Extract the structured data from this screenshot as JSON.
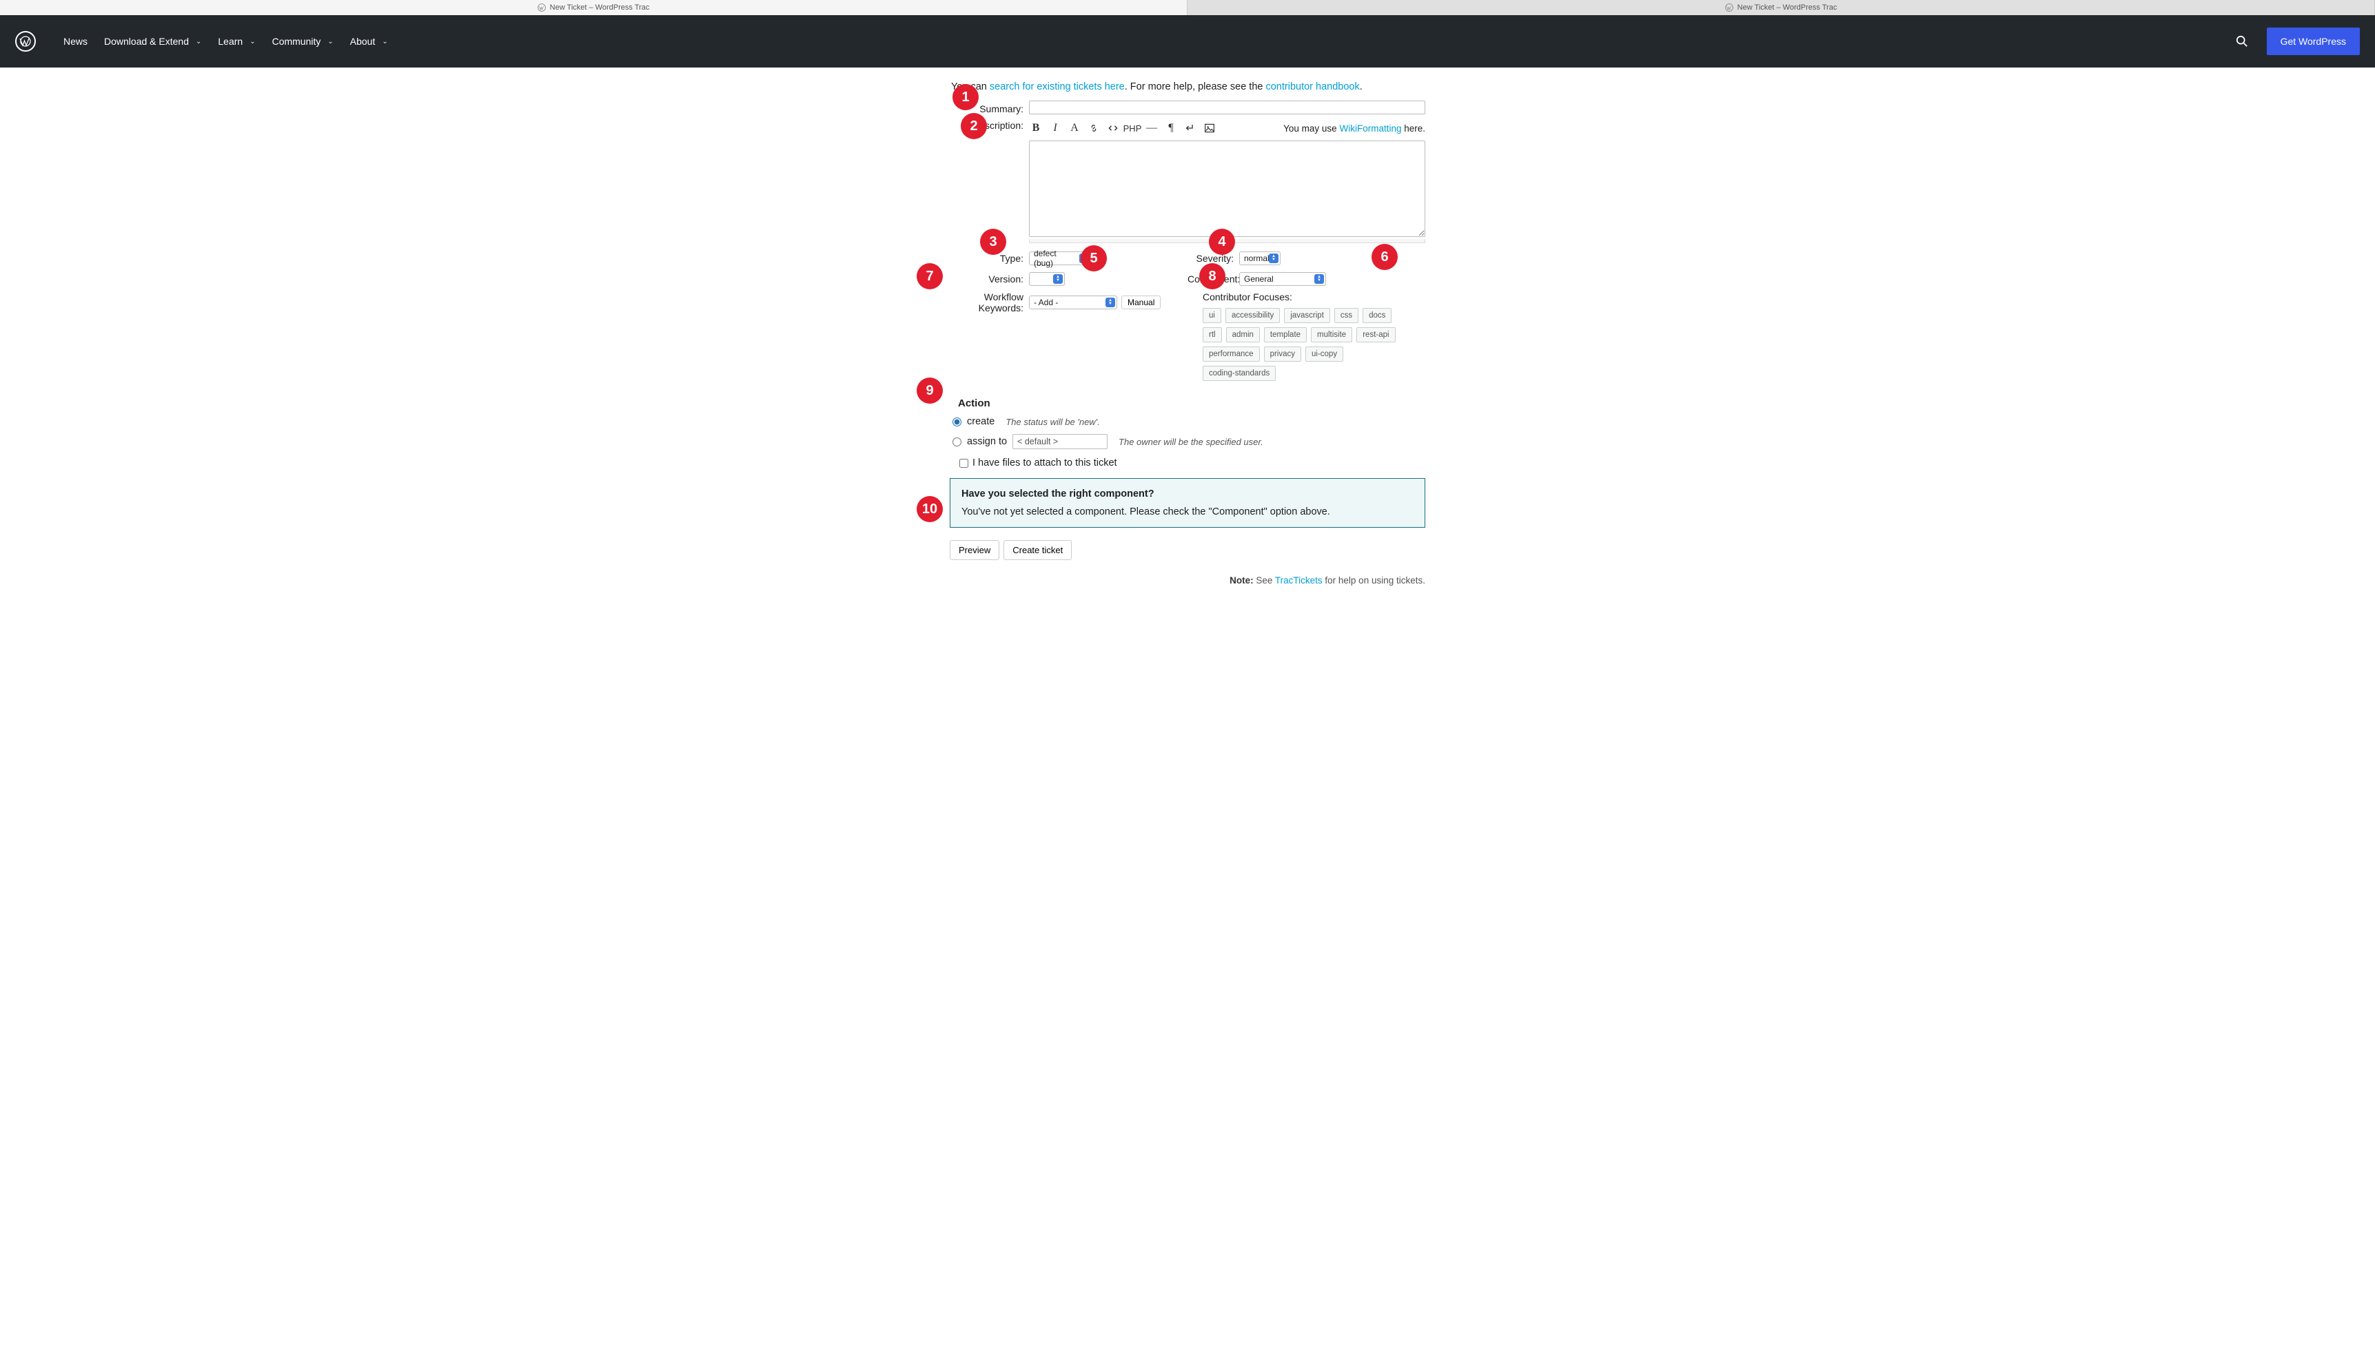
{
  "browser_tabs": [
    {
      "title": "New Ticket – WordPress Trac",
      "active": true
    },
    {
      "title": "New Ticket – WordPress Trac",
      "active": false
    }
  ],
  "nav": {
    "items": [
      "News",
      "Download & Extend",
      "Learn",
      "Community",
      "About"
    ],
    "has_submenu": [
      false,
      true,
      true,
      true,
      true
    ],
    "cta": "Get WordPress"
  },
  "intro": {
    "prefix": "You can ",
    "search_link": "search for existing tickets here",
    "mid": ". For more help, please see the ",
    "handbook_link": "contributor handbook",
    "suffix": "."
  },
  "labels": {
    "summary": "Summary:",
    "description": "Description:",
    "type": "Type:",
    "severity": "Severity:",
    "version": "Version:",
    "component": "Component:",
    "workflow": "Workflow Keywords:",
    "focuses": "Contributor Focuses:"
  },
  "toolbar": {
    "hint_prefix": "You may use ",
    "hint_link": "WikiFormatting",
    "hint_suffix": " here.",
    "php": "PHP"
  },
  "selects": {
    "type": "defect (bug)",
    "severity": "normal",
    "version": "",
    "component": "General",
    "workflow": "- Add -",
    "manual_btn": "Manual"
  },
  "focuses": [
    "ui",
    "accessibility",
    "javascript",
    "css",
    "docs",
    "rtl",
    "admin",
    "template",
    "multisite",
    "rest-api",
    "performance",
    "privacy",
    "ui-copy",
    "coding-standards"
  ],
  "action": {
    "title": "Action",
    "create_label": "create",
    "create_hint": "The status will be 'new'.",
    "assign_label": "assign to",
    "assign_value": "< default >",
    "assign_hint": "The owner will be the specified user.",
    "attach_label": "I have files to attach to this ticket"
  },
  "component_warning": {
    "question": "Have you selected the right component?",
    "message": "You've not yet selected a component. Please check the \"Component\" option above."
  },
  "buttons": {
    "preview": "Preview",
    "create": "Create ticket"
  },
  "footnote": {
    "note": "Note:",
    "see": " See ",
    "link": "TracTickets",
    "rest": " for help on using tickets."
  },
  "markers": [
    "1",
    "2",
    "3",
    "4",
    "5",
    "6",
    "7",
    "8",
    "9",
    "10"
  ]
}
